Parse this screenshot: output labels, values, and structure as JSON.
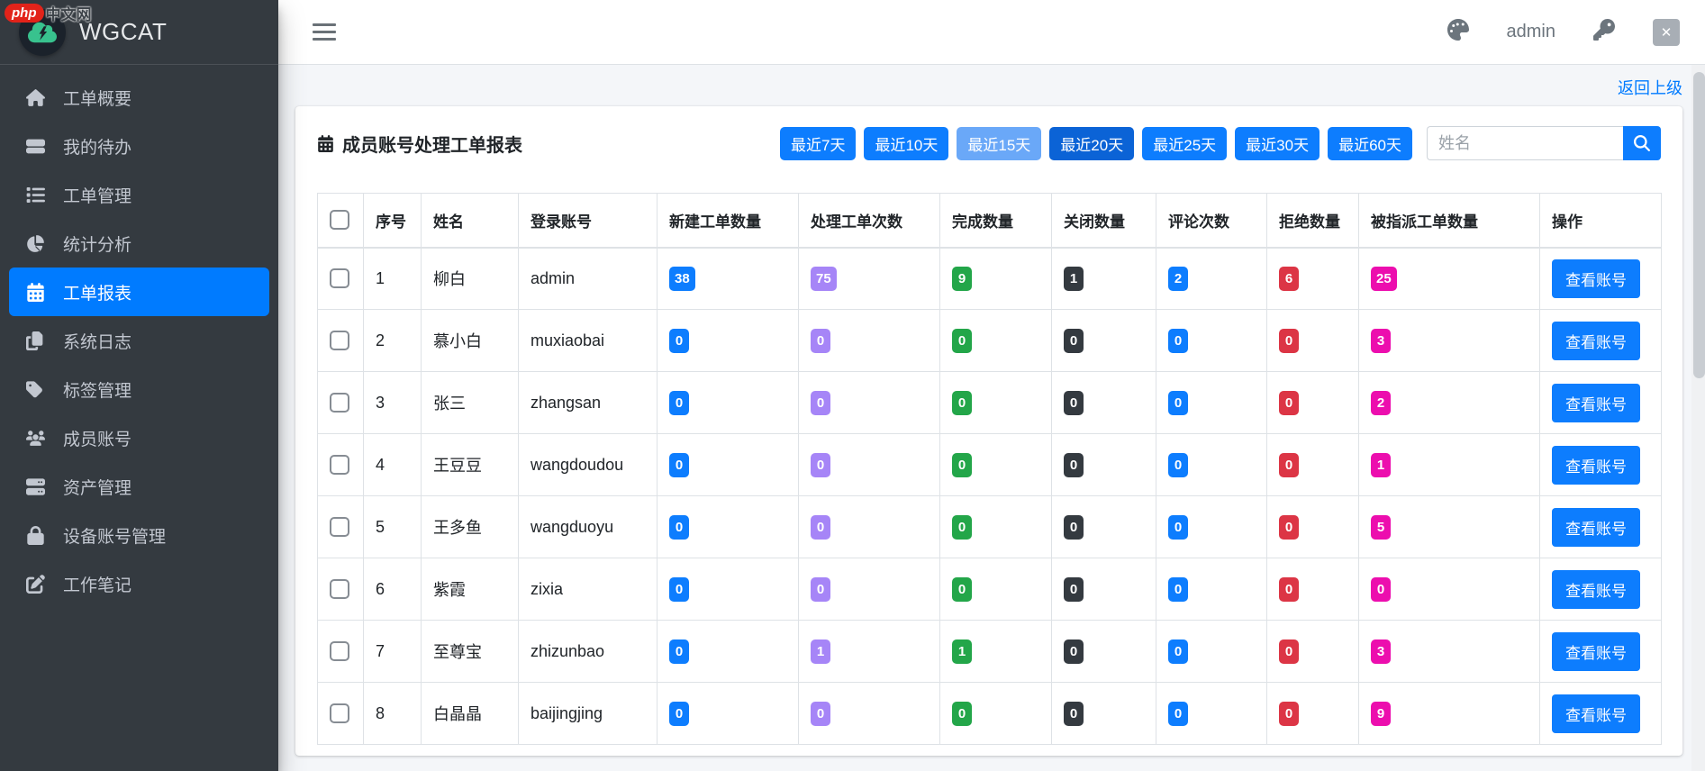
{
  "watermark": {
    "badge": "php",
    "text": "中文网"
  },
  "sidebar": {
    "brand": "WGCAT",
    "items": [
      {
        "label": "工单概要",
        "icon": "home",
        "active": false
      },
      {
        "label": "我的待办",
        "icon": "stacked-bars",
        "active": false
      },
      {
        "label": "工单管理",
        "icon": "list",
        "active": false
      },
      {
        "label": "统计分析",
        "icon": "chart-pie",
        "active": false
      },
      {
        "label": "工单报表",
        "icon": "calendar",
        "active": true
      },
      {
        "label": "系统日志",
        "icon": "copy",
        "active": false
      },
      {
        "label": "标签管理",
        "icon": "tag",
        "active": false
      },
      {
        "label": "成员账号",
        "icon": "users",
        "active": false
      },
      {
        "label": "资产管理",
        "icon": "server",
        "active": false
      },
      {
        "label": "设备账号管理",
        "icon": "lock",
        "active": false
      },
      {
        "label": "工作笔记",
        "icon": "pen-square",
        "active": false
      }
    ],
    "colors": {
      "background": "#343a40",
      "text": "#c2c7d0",
      "active_background": "#007bff"
    }
  },
  "topbar": {
    "username": "admin"
  },
  "content": {
    "back_link": "返回上级",
    "card": {
      "title": "成员账号处理工单报表",
      "filters": [
        {
          "label": "最近7天",
          "state": "normal"
        },
        {
          "label": "最近10天",
          "state": "normal"
        },
        {
          "label": "最近15天",
          "state": "active_light"
        },
        {
          "label": "最近20天",
          "state": "active_dark"
        },
        {
          "label": "最近25天",
          "state": "normal"
        },
        {
          "label": "最近30天",
          "state": "normal"
        },
        {
          "label": "最近60天",
          "state": "normal"
        }
      ],
      "filter_colors": {
        "normal": "#0d7dfe",
        "active_light": "#6aa8f8",
        "active_dark": "#0b63d6"
      },
      "search": {
        "placeholder": "姓名"
      },
      "table": {
        "columns": [
          "",
          "序号",
          "姓名",
          "登录账号",
          "新建工单数量",
          "处理工单次数",
          "完成数量",
          "关闭数量",
          "评论次数",
          "拒绝数量",
          "被指派工单数量",
          "操作"
        ],
        "action_label": "查看账号",
        "badge_styles": [
          "blue",
          "purple",
          "green",
          "dark",
          "blue",
          "red",
          "pink"
        ],
        "badge_colors": {
          "blue": "#0d7dfe",
          "purple": "#a685f7",
          "green": "#23a649",
          "dark": "#343a40",
          "red": "#dc3545",
          "pink": "#ec0eae"
        },
        "rows": [
          {
            "index": "1",
            "name": "柳白",
            "account": "admin",
            "values": [
              "38",
              "75",
              "9",
              "1",
              "2",
              "6",
              "25"
            ]
          },
          {
            "index": "2",
            "name": "慕小白",
            "account": "muxiaobai",
            "values": [
              "0",
              "0",
              "0",
              "0",
              "0",
              "0",
              "3"
            ]
          },
          {
            "index": "3",
            "name": "张三",
            "account": "zhangsan",
            "values": [
              "0",
              "0",
              "0",
              "0",
              "0",
              "0",
              "2"
            ]
          },
          {
            "index": "4",
            "name": "王豆豆",
            "account": "wangdoudou",
            "values": [
              "0",
              "0",
              "0",
              "0",
              "0",
              "0",
              "1"
            ]
          },
          {
            "index": "5",
            "name": "王多鱼",
            "account": "wangduoyu",
            "values": [
              "0",
              "0",
              "0",
              "0",
              "0",
              "0",
              "5"
            ]
          },
          {
            "index": "6",
            "name": "紫霞",
            "account": "zixia",
            "values": [
              "0",
              "0",
              "0",
              "0",
              "0",
              "0",
              "0"
            ]
          },
          {
            "index": "7",
            "name": "至尊宝",
            "account": "zhizunbao",
            "values": [
              "0",
              "1",
              "1",
              "0",
              "0",
              "0",
              "3"
            ]
          },
          {
            "index": "8",
            "name": "白晶晶",
            "account": "baijingjing",
            "values": [
              "0",
              "0",
              "0",
              "0",
              "0",
              "0",
              "9"
            ]
          }
        ]
      }
    }
  }
}
